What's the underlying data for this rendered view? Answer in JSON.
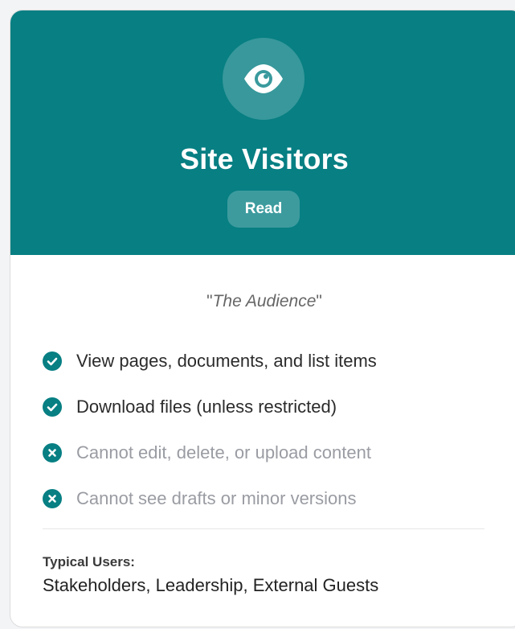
{
  "card": {
    "title": "Site Visitors",
    "badge": "Read",
    "icon": "eye-icon",
    "header_color": "#077f83",
    "subtitle": "The Audience",
    "subtitle_open_quote": "\"",
    "subtitle_close_quote": "\""
  },
  "permissions": [
    {
      "text": "View pages, documents, and list items",
      "allowed": true,
      "icon": "check-circle-icon"
    },
    {
      "text": "Download files (unless restricted)",
      "allowed": true,
      "icon": "check-circle-icon"
    },
    {
      "text": "Cannot edit, delete, or upload content",
      "allowed": false,
      "icon": "x-circle-icon"
    },
    {
      "text": "Cannot see drafts or minor versions",
      "allowed": false,
      "icon": "x-circle-icon"
    }
  ],
  "typical_users": {
    "label": "Typical Users:",
    "value": "Stakeholders, Leadership, External Guests"
  },
  "colors": {
    "accent": "#077f83",
    "denied_text": "#9a9ca3",
    "allowed_text": "#2b2b2b"
  }
}
